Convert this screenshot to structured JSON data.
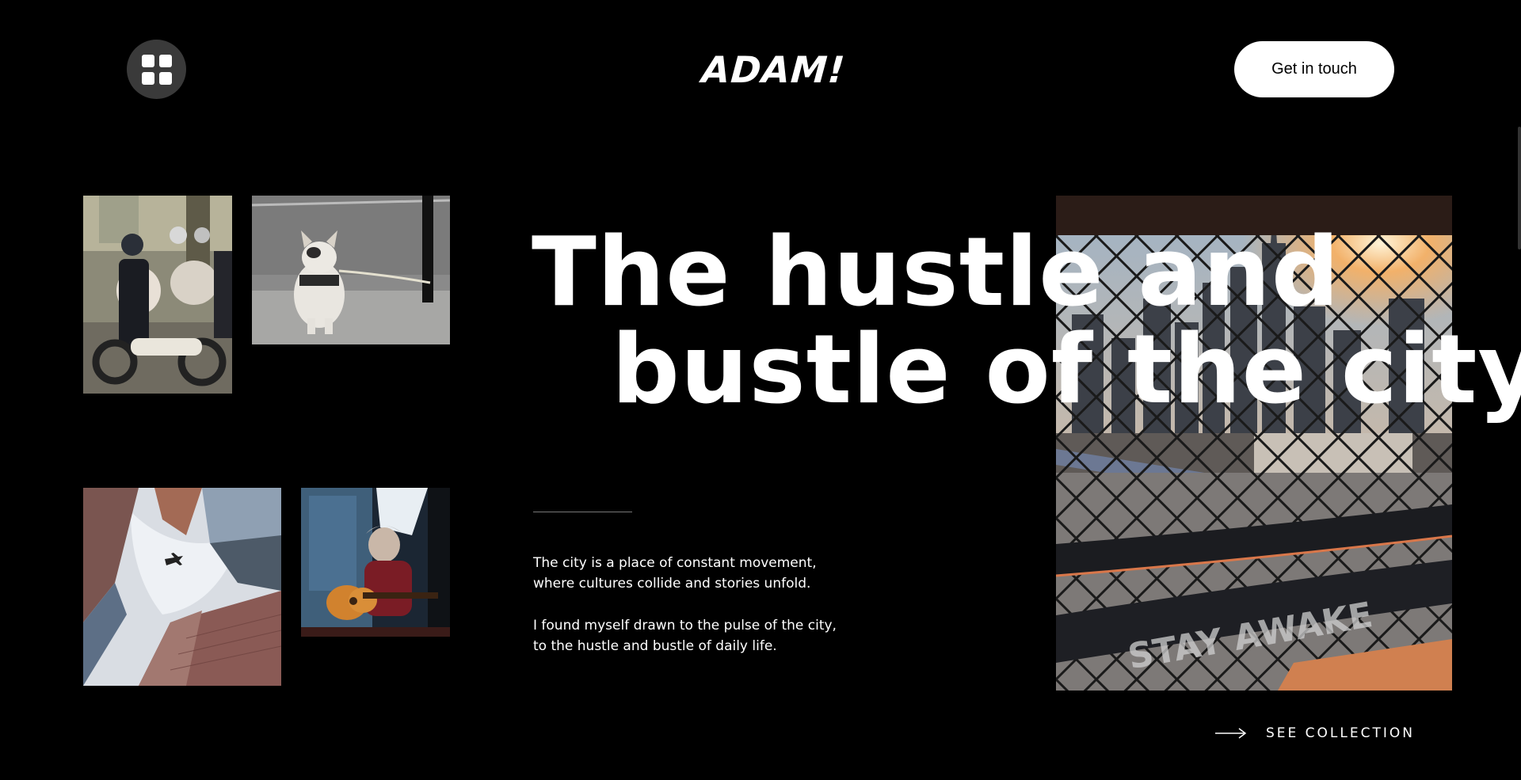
{
  "header": {
    "menu_icon": "grid-icon",
    "logo": "ADAM!",
    "cta_label": "Get in touch"
  },
  "hero": {
    "headline_line1": "The hustle and",
    "headline_line2": "bustle of the city",
    "paragraph1": "The city is a place of constant movement, where cultures collide and stories unfold.",
    "paragraph2": "I found myself drawn to the pulse of the city, to the hustle and bustle of daily life."
  },
  "gallery": {
    "photos": [
      {
        "name": "street-motorbike-photo"
      },
      {
        "name": "french-bulldog-photo"
      },
      {
        "name": "skyscrapers-airplane-photo"
      },
      {
        "name": "guitar-player-photo"
      },
      {
        "name": "city-skyline-fence-photo"
      }
    ]
  },
  "footer_link": {
    "icon": "arrow-right-icon",
    "label": "SEE COLLECTION"
  },
  "colors": {
    "background": "#000000",
    "text": "#ffffff",
    "menu_button": "#3a3a3a"
  }
}
